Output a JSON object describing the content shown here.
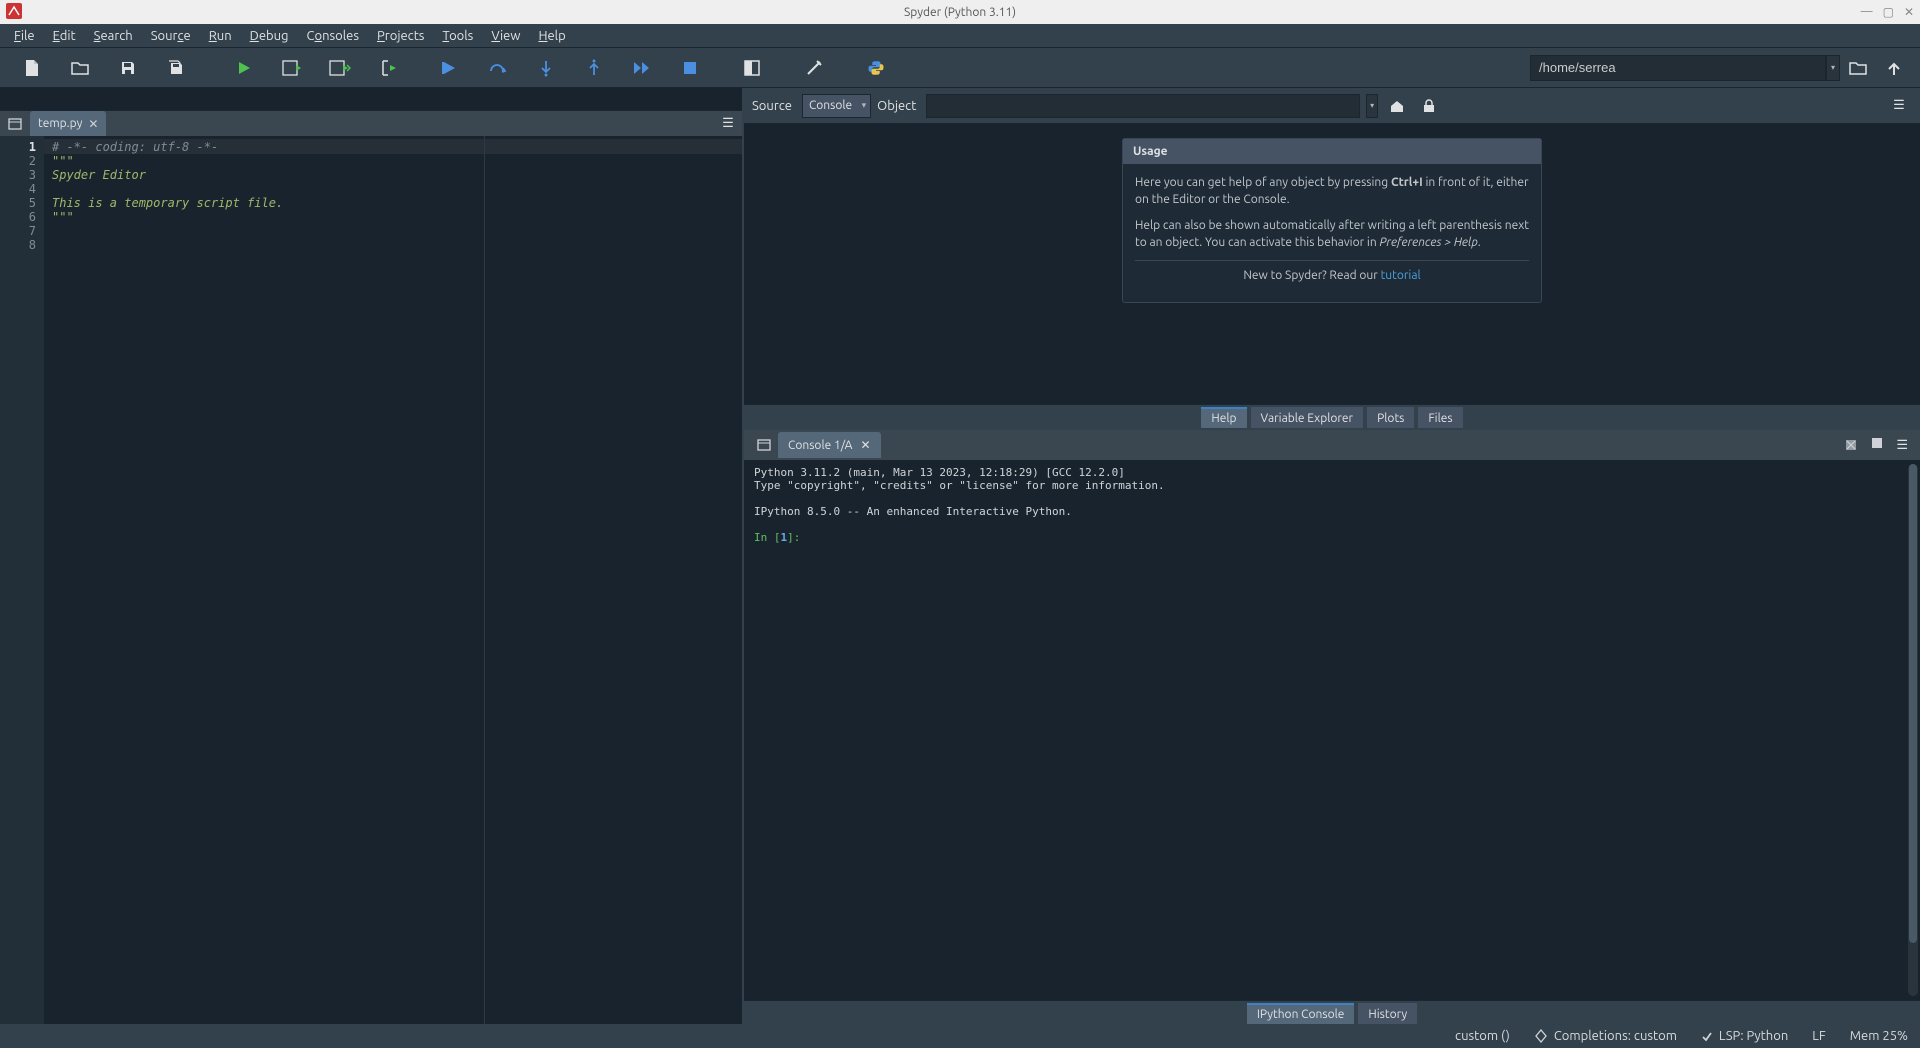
{
  "window": {
    "title": "Spyder (Python 3.11)"
  },
  "menu": {
    "file": "File",
    "edit": "Edit",
    "search": "Search",
    "source": "Source",
    "run": "Run",
    "debug": "Debug",
    "consoles": "Consoles",
    "projects": "Projects",
    "tools": "Tools",
    "view": "View",
    "help": "Help"
  },
  "toolbar": {
    "working_dir": "/home/serrea"
  },
  "editor": {
    "tab_name": "temp.py",
    "lines": {
      "l1": "# -*- coding: utf-8 -*-",
      "l2": "\"\"\"",
      "l3": "Spyder Editor",
      "l4": "",
      "l5": "This is a temporary script file.",
      "l6": "\"\"\"",
      "l7": "",
      "l8": ""
    },
    "line_numbers": [
      "1",
      "2",
      "3",
      "4",
      "5",
      "6",
      "7",
      "8"
    ]
  },
  "help": {
    "source_label": "Source",
    "source_value": "Console",
    "object_label": "Object",
    "usage_title": "Usage",
    "usage_p1_a": "Here you can get help of any object by pressing ",
    "usage_p1_key": "Ctrl+I",
    "usage_p1_b": " in front of it, either on the Editor or the Console.",
    "usage_p2_a": "Help can also be shown automatically after writing a left parenthesis next to an object. You can activate this behavior in ",
    "usage_p2_i": "Preferences > Help",
    "usage_p2_b": ".",
    "usage_foot_a": "New to Spyder? Read our ",
    "usage_foot_link": "tutorial",
    "tabs": {
      "help": "Help",
      "varexp": "Variable Explorer",
      "plots": "Plots",
      "files": "Files"
    }
  },
  "console": {
    "tab_name": "Console 1/A",
    "banner_l1": "Python 3.11.2 (main, Mar 13 2023, 12:18:29) [GCC 12.2.0]",
    "banner_l2": "Type \"copyright\", \"credits\" or \"license\" for more information.",
    "banner_l3": "IPython 8.5.0 -- An enhanced Interactive Python.",
    "prompt_in": "In [",
    "prompt_num": "1",
    "prompt_close": "]:",
    "tabs": {
      "ipython": "IPython Console",
      "history": "History"
    }
  },
  "status": {
    "interpreter": "custom ()",
    "completions": "Completions: custom",
    "lsp": "LSP: Python",
    "eol": "LF",
    "mem": "Mem 25%"
  }
}
